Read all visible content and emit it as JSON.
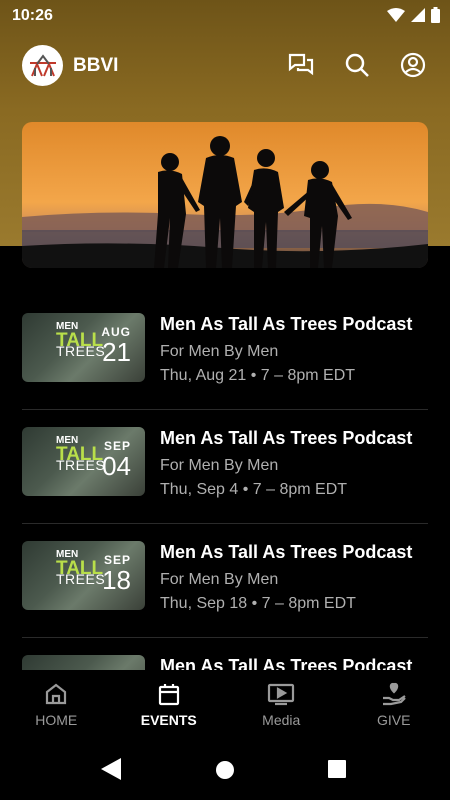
{
  "status": {
    "time": "10:26"
  },
  "app": {
    "title": "BBVI"
  },
  "events": [
    {
      "title": "Men As Tall As Trees Podcast",
      "subtitle": "For Men By Men",
      "time": "Thu, Aug 21 • 7 – 8pm EDT",
      "thumb_month": "AUG",
      "thumb_day": "21"
    },
    {
      "title": "Men As Tall As Trees Podcast",
      "subtitle": "For Men By Men",
      "time": "Thu, Sep 4 • 7 – 8pm EDT",
      "thumb_month": "SEP",
      "thumb_day": "04"
    },
    {
      "title": "Men As Tall As Trees Podcast",
      "subtitle": "For Men By Men",
      "time": "Thu, Sep 18 • 7 – 8pm EDT",
      "thumb_month": "SEP",
      "thumb_day": "18"
    },
    {
      "title": "Men As Tall As Trees Podcast",
      "subtitle": "",
      "time": "",
      "thumb_month": "",
      "thumb_day": ""
    }
  ],
  "thumb_text": {
    "men": "MEN",
    "tall": "TALL",
    "trees": "TREES"
  },
  "nav": [
    {
      "label": "HOME",
      "icon": "home-icon"
    },
    {
      "label": "EVENTS",
      "icon": "calendar-icon",
      "active": true
    },
    {
      "label": "Media",
      "icon": "video-icon"
    },
    {
      "label": "GIVE",
      "icon": "give-icon"
    }
  ],
  "colors": {
    "header": "#8a6a22",
    "accent_green": "#b9df4a",
    "muted_text": "#b0b0b0"
  }
}
